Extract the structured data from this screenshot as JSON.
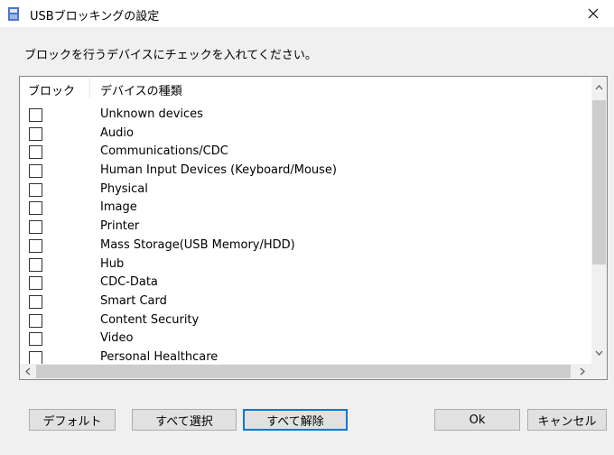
{
  "window": {
    "title": "USBブロッキングの設定",
    "close_glyph": "✕"
  },
  "instruction": "ブロックを行うデバイスにチェックを入れてください。",
  "table": {
    "headers": [
      "ブロック",
      "デバイスの種類"
    ],
    "rows": [
      {
        "checked": false,
        "label": "Unknown devices"
      },
      {
        "checked": false,
        "label": "Audio"
      },
      {
        "checked": false,
        "label": "Communications/CDC"
      },
      {
        "checked": false,
        "label": "Human Input Devices (Keyboard/Mouse)"
      },
      {
        "checked": false,
        "label": "Physical"
      },
      {
        "checked": false,
        "label": "Image"
      },
      {
        "checked": false,
        "label": "Printer"
      },
      {
        "checked": false,
        "label": "Mass Storage(USB Memory/HDD)"
      },
      {
        "checked": false,
        "label": "Hub"
      },
      {
        "checked": false,
        "label": "CDC-Data"
      },
      {
        "checked": false,
        "label": "Smart Card"
      },
      {
        "checked": false,
        "label": "Content Security"
      },
      {
        "checked": false,
        "label": "Video"
      },
      {
        "checked": false,
        "label": "Personal Healthcare"
      }
    ]
  },
  "buttons": {
    "default": "デフォルト",
    "select_all": "すべて選択",
    "deselect_all": "すべて解除",
    "ok": "Ok",
    "cancel": "キャンセル"
  },
  "icons": {
    "title": "usb-settings-icon",
    "close": "close-icon",
    "scroll_up": "chevron-up-icon",
    "scroll_down": "chevron-down-icon",
    "scroll_left": "chevron-left-icon",
    "scroll_right": "chevron-right-icon"
  },
  "colors": {
    "focus_border": "#0078d7",
    "dialog_bg": "#f0f0f0"
  }
}
